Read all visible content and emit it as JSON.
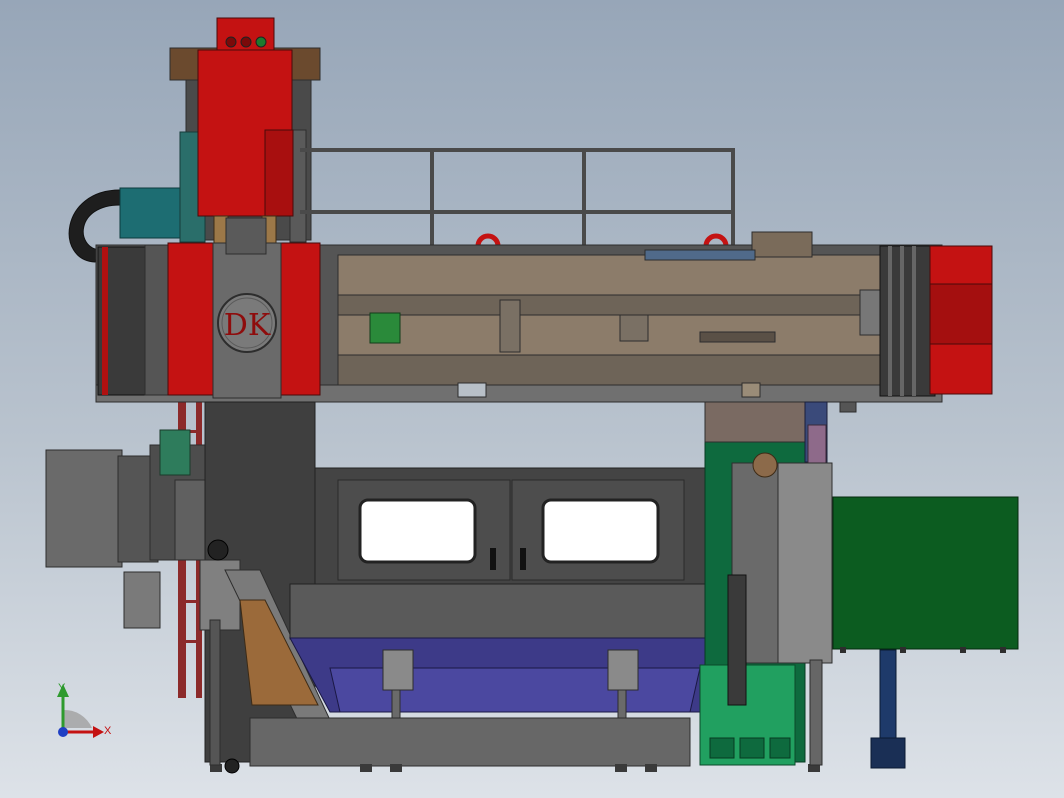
{
  "scene": {
    "logo_text": "DK",
    "axis": {
      "y_label": "Y",
      "x_label": "X"
    }
  },
  "colors": {
    "background_top": "#97a6b8",
    "background_bottom": "#dde2e8",
    "spindle_red": "#c41212",
    "dark_red": "#8e0c0c",
    "crossbeam_tan": "#8c7c6a",
    "machine_gray": "#5f5f5f",
    "dark_gray": "#3f3f3f",
    "table_blue": "#3d3a88",
    "cabinet_green": "#0e6a3e",
    "coolant_green": "#21a060",
    "teal": "#1d6d72",
    "railing_gray": "#4a4a4a"
  }
}
